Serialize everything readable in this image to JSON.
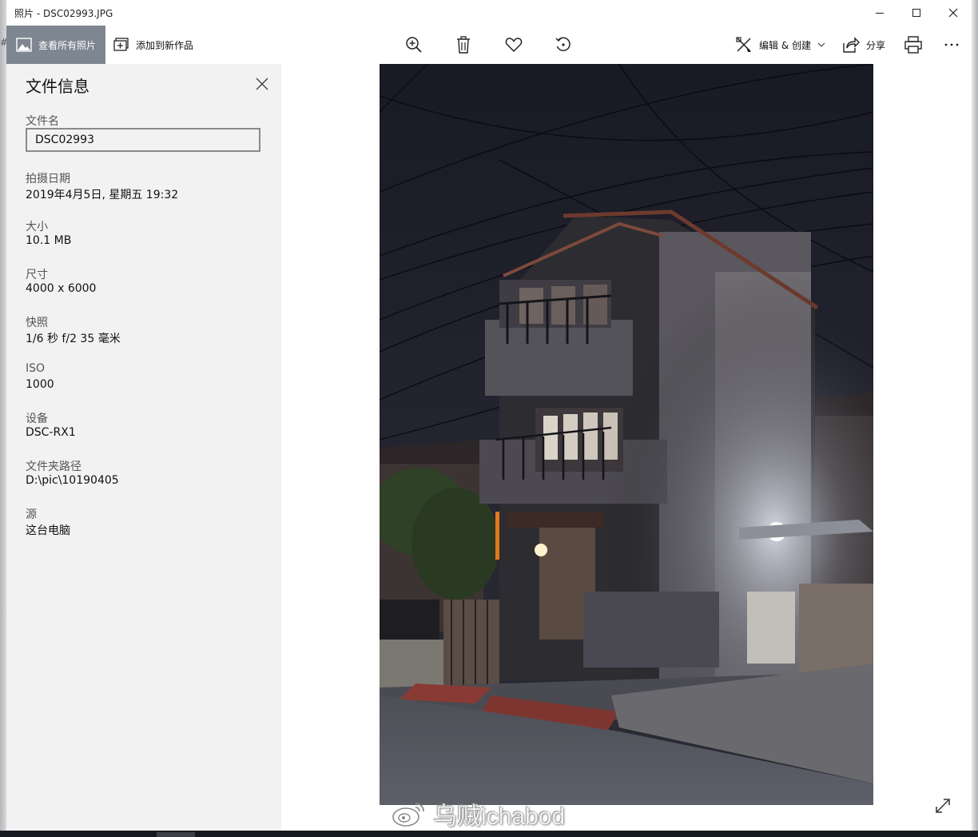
{
  "window": {
    "title": "照片 - DSC02993.JPG",
    "edge_mark": "#"
  },
  "toolbar": {
    "all_photos_label": "查看所有照片",
    "add_to_creation_label": "添加到新作品",
    "edit_create_label": "编辑 & 创建",
    "share_label": "分享",
    "icons": [
      "zoom-in-icon",
      "delete-icon",
      "favorite-heart-icon",
      "rotate-icon",
      "edit-create-icon",
      "share-icon",
      "print-icon",
      "more-icon"
    ],
    "accent_color": "#7d8691"
  },
  "info_panel": {
    "title": "文件信息",
    "filename": {
      "label": "文件名",
      "value": "DSC02993"
    },
    "date_taken": {
      "label": "拍摄日期",
      "value": "2019年4月5日, 星期五 19:32"
    },
    "size": {
      "label": "大小",
      "value": "10.1 MB"
    },
    "dimensions": {
      "label": "尺寸",
      "value": "4000 x 6000"
    },
    "snapshot": {
      "label": "快照",
      "value": "1/6 秒 f/2 35 毫米"
    },
    "iso": {
      "label": "ISO",
      "value": "1000"
    },
    "device": {
      "label": "设备",
      "value": "DSC-RX1"
    },
    "folder_path": {
      "label": "文件夹路径",
      "value": "D:\\pic\\10190405"
    },
    "source": {
      "label": "源",
      "value": "这台电脑"
    }
  },
  "watermark": {
    "text": "乌贼ichabod"
  }
}
